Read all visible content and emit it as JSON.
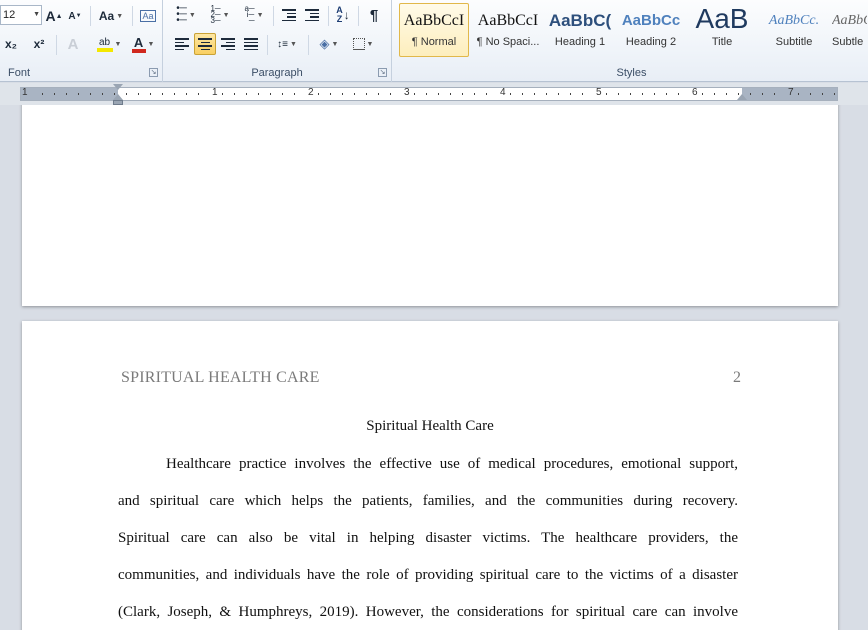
{
  "ribbon": {
    "font_group": {
      "label": "Font",
      "font_size": "12",
      "grow_font": "A",
      "shrink_font": "A",
      "change_case": "Aa",
      "subscript": "x₂",
      "superscript": "x²",
      "highlight": "ab",
      "font_color": "A"
    },
    "paragraph_group": {
      "label": "Paragraph",
      "show_marks": "¶",
      "sort": "A↓Z"
    },
    "styles_group": {
      "label": "Styles",
      "items": [
        {
          "sample": "AaBbCcI",
          "name": "¶ Normal"
        },
        {
          "sample": "AaBbCcI",
          "name": "¶ No Spaci..."
        },
        {
          "sample": "AaBbC(",
          "name": "Heading 1"
        },
        {
          "sample": "AaBbCc",
          "name": "Heading 2"
        },
        {
          "sample": "AaB",
          "name": "Title"
        },
        {
          "sample": "AaBbCc.",
          "name": "Subtitle"
        },
        {
          "sample": "AaBbCcI",
          "name": "Subtle"
        }
      ]
    }
  },
  "ruler": {
    "numbers": [
      "1",
      "1",
      "2",
      "3",
      "4",
      "5",
      "6",
      "7"
    ]
  },
  "document": {
    "running_head": "SPIRITUAL HEALTH CARE",
    "page_number": "2",
    "title": "Spiritual Health Care",
    "lines": [
      "Healthcare practice involves the effective use of medical procedures, emotional support,",
      "and spiritual care which helps the patients, families, and the communities during recovery.",
      "Spiritual care can also be vital in helping disaster victims. The healthcare providers, the",
      "communities, and individuals have the role of providing spiritual care to the victims of a disaster",
      "(Clark, Joseph, & Humphreys, 2019). However, the considerations for spiritual care can involve"
    ]
  },
  "colors": {
    "ribbon_bg": "#e8eef6",
    "doc_bg": "#d8dde5",
    "selected_style": "#fdeebd",
    "heading_blue": "#2d4f7c",
    "font_color_red": "#d0281e",
    "highlight_yellow": "#f4e800"
  }
}
